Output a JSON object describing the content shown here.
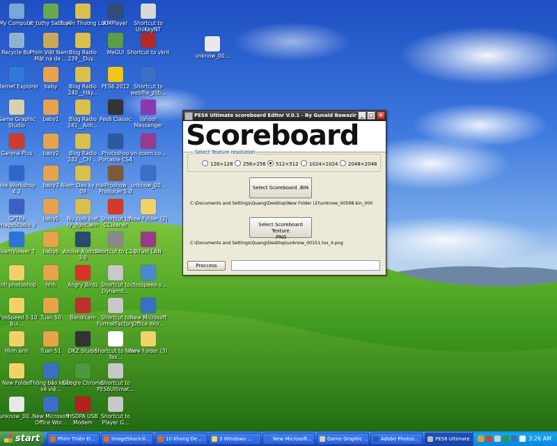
{
  "desktop": {
    "icons": [
      {
        "label": "My Computer",
        "icon": "computer-icon",
        "color": "#7aa6d6"
      },
      {
        "label": "Recycle Bin",
        "icon": "recycle-bin-icon",
        "color": "#8fb3cf"
      },
      {
        "label": "Internet Explorer",
        "icon": "internet-explorer-icon",
        "color": "#2f7ad8"
      },
      {
        "label": "Game Graphic Studio",
        "icon": "game-graphic-studio-icon",
        "color": "#d6d0b0"
      },
      {
        "label": "Garena Plus",
        "icon": "garena-icon",
        "color": "#d23b2a"
      },
      {
        "label": "Hex Workshop 4.2",
        "icon": "hex-workshop-icon",
        "color": "#2d67c8"
      },
      {
        "label": "GPTRs ImageStudio 3",
        "icon": "imagestudio-icon",
        "color": "#3d5fc4"
      },
      {
        "label": "TeamViewer 7",
        "icon": "teamviewer-icon",
        "color": "#2a73d8"
      },
      {
        "label": "Anh photoshop",
        "icon": "folder-icon",
        "color": "#f2d169"
      },
      {
        "label": "cFosSpeed 5.10 Bui...",
        "icon": "folder-icon",
        "color": "#f2d169"
      },
      {
        "label": "Hình ảnh",
        "icon": "folder-icon",
        "color": "#f2d169"
      },
      {
        "label": "New Folder",
        "icon": "folder-icon",
        "color": "#f2d169"
      },
      {
        "label": "unknow_00...",
        "icon": "file-icon",
        "color": "#e8e8e8"
      },
      {
        "label": "It_tuthy Sabouki",
        "icon": "media-icon",
        "color": "#6aa84f"
      },
      {
        "label": "Phim Việt Nam - Mặt nạ da ...",
        "icon": "media-icon",
        "color": "#c8a95a"
      },
      {
        "label": "baby",
        "icon": "image-file-icon",
        "color": "#e8a34a"
      },
      {
        "label": "baby1",
        "icon": "image-file-icon",
        "color": "#e8a34a"
      },
      {
        "label": "baby2",
        "icon": "image-file-icon",
        "color": "#e8a34a"
      },
      {
        "label": "baby3",
        "icon": "image-file-icon",
        "color": "#e8a34a"
      },
      {
        "label": "baby5",
        "icon": "image-file-icon",
        "color": "#e8a34a"
      },
      {
        "label": "baby6",
        "icon": "image-file-icon",
        "color": "#e8a34a"
      },
      {
        "label": "hhh",
        "icon": "image-file-icon",
        "color": "#e8a34a"
      },
      {
        "label": "Tuan 50",
        "icon": "image-file-icon",
        "color": "#e8a34a"
      },
      {
        "label": "Tuan 51",
        "icon": "image-file-icon",
        "color": "#e8a34a"
      },
      {
        "label": "Thông báo khẩn về việ...",
        "icon": "word-doc-icon",
        "color": "#3a6fc7"
      },
      {
        "label": "New Microsoft Office Wor...",
        "icon": "word-doc-icon",
        "color": "#3a6fc7"
      },
      {
        "label": "Tuyên Thương Lời",
        "icon": "audio-icon",
        "color": "#d9c04a"
      },
      {
        "label": "Blog Radio 239__Duy...",
        "icon": "audio-icon",
        "color": "#d9c04a"
      },
      {
        "label": "Blog Radio 240__Hãy...",
        "icon": "audio-icon",
        "color": "#d9c04a"
      },
      {
        "label": "Blog Radio 241__Anh...",
        "icon": "audio-icon",
        "color": "#d9c04a"
      },
      {
        "label": "Blog Radio 242__Chỉ ...",
        "icon": "audio-icon",
        "color": "#d9c04a"
      },
      {
        "label": "Niem Dau ky Hai 09",
        "icon": "audio-icon",
        "color": "#d9c04a"
      },
      {
        "label": "Nu cuoi biet ly_dgoc.wm",
        "icon": "audio-icon",
        "color": "#d9c04a"
      },
      {
        "label": "Adobe Audition 3.0",
        "icon": "audition-icon",
        "color": "#2b4a6e"
      },
      {
        "label": "Angry Birds",
        "icon": "angry-birds-icon",
        "color": "#d9322a"
      },
      {
        "label": "Bandicam",
        "icon": "bandicam-icon",
        "color": "#c0302a"
      },
      {
        "label": "DKZ Studio",
        "icon": "dkz-studio-icon",
        "color": "#333333"
      },
      {
        "label": "Google Chrome",
        "icon": "chrome-icon",
        "color": "#4c9a3c"
      },
      {
        "label": "HSDPA USB Modem",
        "icon": "modem-icon",
        "color": "#b82020"
      },
      {
        "label": "KMPlayer",
        "icon": "kmplayer-icon",
        "color": "#324b7a"
      },
      {
        "label": "MeGUI",
        "icon": "megui-icon",
        "color": "#5a9e46"
      },
      {
        "label": "PES6 2012",
        "icon": "pes-icon",
        "color": "#f0c419"
      },
      {
        "label": "Pes6 Classic",
        "icon": "pes-icon",
        "color": "#333333"
      },
      {
        "label": "Photoshop Portable CS4",
        "icon": "photoshop-icon",
        "color": "#2c5aa0"
      },
      {
        "label": "Proshow Producer 5.0",
        "icon": "proshow-icon",
        "color": "#7a5a3a"
      },
      {
        "label": "Shortcut to CCleaner",
        "icon": "ccleaner-icon",
        "color": "#d23a2a"
      },
      {
        "label": "Shortcut to C14",
        "icon": "shortcut-icon",
        "color": "#8a8a8a"
      },
      {
        "label": "Shortcut to Dynamit...",
        "icon": "shortcut-icon",
        "color": "#c8c8c8"
      },
      {
        "label": "Shortcut to FormatFactory",
        "icon": "formatfactory-icon",
        "color": "#c8c8c8"
      },
      {
        "label": "Shortcut to New Tex...",
        "icon": "text-file-icon",
        "color": "#ffffff"
      },
      {
        "label": "Shortcut to PES6Ultimat...",
        "icon": "shortcut-icon",
        "color": "#c8c8c8"
      },
      {
        "label": "Shortcut to Player G...",
        "icon": "shortcut-icon",
        "color": "#c8c8c8"
      },
      {
        "label": "Shortcut to UniKeyNT",
        "icon": "unikey-icon",
        "color": "#d8d8d8"
      },
      {
        "label": "Shortcut to vknt",
        "icon": "vknt-icon",
        "color": "#b02a2a"
      },
      {
        "label": "Shortcut to webfile_zlib...",
        "icon": "webfile-icon",
        "color": "#3a6fc7"
      },
      {
        "label": "Yahoo! Messenger",
        "icon": "yahoo-messenger-icon",
        "color": "#8a3ab0"
      },
      {
        "label": "vn-zoom.co...",
        "icon": "winrar-icon",
        "color": "#9a3a8a"
      },
      {
        "label": "unknow_00...",
        "icon": "image-file-icon",
        "color": "#3a6fc7"
      },
      {
        "label": "New Folder (2)",
        "icon": "folder-icon",
        "color": "#f2d169"
      },
      {
        "label": "XFast LAN",
        "icon": "winrar-icon",
        "color": "#9a3a8a"
      },
      {
        "label": "cfosspeed-v...",
        "icon": "installer-icon",
        "color": "#4a88d0"
      },
      {
        "label": "New Microsoft Office Wor...",
        "icon": "word-doc-icon",
        "color": "#3a6fc7"
      },
      {
        "label": "New Folder (3)",
        "icon": "folder-icon",
        "color": "#f2d169"
      }
    ],
    "extra_icon": {
      "label": "unknow_00...",
      "icon": "file-icon",
      "color": "#e8e8e8"
    }
  },
  "app": {
    "title": "PES6 Ultimate scoreboard Editor V.0.1 - By Gunaid Bawazir",
    "banner": "Scoreboard",
    "group_label": "Select Texture resolution",
    "resolutions": [
      {
        "label": "128×128",
        "selected": false
      },
      {
        "label": "256×256",
        "selected": false
      },
      {
        "label": "512×512",
        "selected": true
      },
      {
        "label": "1024×1024",
        "selected": false
      },
      {
        "label": "2048×2048",
        "selected": false
      }
    ],
    "select_bin_label": "Select Scoreboard .BIN",
    "bin_path": "C:\\Documents and Settings\\Quang\\Desktop\\New Folder (2)\\unknow_00598.bin_000",
    "select_png_label_1": "Select Scoreboard Texture",
    "select_png_label_2": ".PNG",
    "png_path": "C:\\Documents and Settings\\Quang\\Desktop\\unknow_00151.txs_4.png",
    "process_label": "Proccess",
    "process_value": "",
    "btn_min": "_",
    "btn_max": "□",
    "btn_close": "×"
  },
  "taskbar": {
    "start_label": "start",
    "items": [
      {
        "label": "Phim Thiên Đ...",
        "color": "#e06b2a",
        "active": false
      },
      {
        "label": "ImageShack®...",
        "color": "#e06b2a",
        "active": false
      },
      {
        "label": "10 Khong De ...",
        "color": "#e06b2a",
        "active": false
      },
      {
        "label": "3 Windows ...",
        "color": "#f2d169",
        "active": false
      },
      {
        "label": "New Microsoft...",
        "color": "#3a6fc7",
        "active": false
      },
      {
        "label": "Game Graphic ...",
        "color": "#d6d0b0",
        "active": false
      },
      {
        "label": "Adobe Photos...",
        "color": "#2c5aa0",
        "active": false
      },
      {
        "label": "PES6 Ultimate ...",
        "color": "#bbbbbb",
        "active": true
      }
    ],
    "clock": "3:26 AM"
  }
}
